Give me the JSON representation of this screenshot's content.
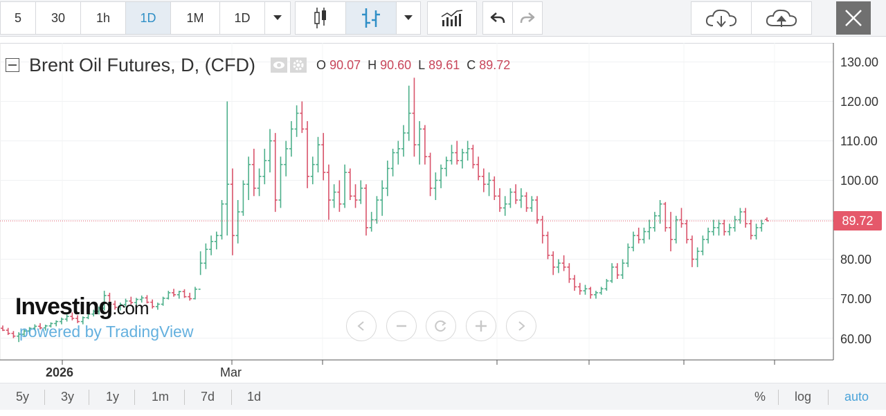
{
  "toolbar": {
    "intervals": [
      {
        "label": "5",
        "active": false
      },
      {
        "label": "30",
        "active": false
      },
      {
        "label": "1h",
        "active": false
      },
      {
        "label": "1D",
        "active": true
      },
      {
        "label": "1M",
        "active": false
      },
      {
        "label": "1D",
        "active": false
      }
    ],
    "icons": [
      "chevron-down-icon",
      "candlestick-icon",
      "ohlc-bars-icon",
      "chevron-down-icon",
      "indicators-icon",
      "undo-icon",
      "redo-icon",
      "cloud-download-icon",
      "cloud-upload-icon",
      "close-icon"
    ]
  },
  "legend": {
    "title": "Brent Oil Futures, D, (CFD)",
    "open_label": "O",
    "open": "90.07",
    "high_label": "H",
    "high": "90.60",
    "low_label": "L",
    "low": "89.61",
    "close_label": "C",
    "close": "89.72"
  },
  "price_tag": "89.72",
  "y_axis_labels": [
    "130.00",
    "120.00",
    "110.00",
    "100.00",
    "80.00",
    "70.00",
    "60.00"
  ],
  "x_axis_labels": {
    "year": "2026",
    "month": "Mar"
  },
  "watermark": {
    "brand": "Investing",
    "brand_suffix": ".com",
    "powered": "powered by TradingView"
  },
  "range_buttons": [
    "5y",
    "3y",
    "1y",
    "1m",
    "7d",
    "1d"
  ],
  "right_options": {
    "percent": "%",
    "log": "log",
    "auto": "auto"
  },
  "colors": {
    "up": "#4caf8a",
    "down": "#d9536a",
    "accent": "#2f8fc6",
    "price_tag": "#e5586a"
  },
  "chart_data": {
    "type": "ohlc",
    "title": "Brent Oil Futures, D, (CFD)",
    "ylim": [
      55,
      133
    ],
    "last_close": 89.72,
    "series": [
      {
        "values": [
          {
            "o": 62.5,
            "h": 63.2,
            "l": 61.8,
            "c": 62.0
          },
          {
            "o": 62.0,
            "h": 62.6,
            "l": 60.8,
            "c": 61.2
          },
          {
            "o": 61.2,
            "h": 61.8,
            "l": 60.0,
            "c": 60.5
          },
          {
            "o": 60.5,
            "h": 61.5,
            "l": 59.0,
            "c": 61.0
          },
          {
            "o": 61.0,
            "h": 62.2,
            "l": 60.5,
            "c": 61.8
          },
          {
            "o": 61.8,
            "h": 62.8,
            "l": 61.2,
            "c": 62.5
          },
          {
            "o": 62.5,
            "h": 63.5,
            "l": 62.0,
            "c": 63.0
          },
          {
            "o": 63.0,
            "h": 63.8,
            "l": 62.2,
            "c": 62.6
          },
          {
            "o": 62.6,
            "h": 63.4,
            "l": 61.9,
            "c": 63.1
          },
          {
            "o": 63.1,
            "h": 64.0,
            "l": 62.7,
            "c": 63.7
          },
          {
            "o": 63.7,
            "h": 64.5,
            "l": 63.0,
            "c": 64.2
          },
          {
            "o": 64.2,
            "h": 65.2,
            "l": 63.5,
            "c": 64.8
          },
          {
            "o": 64.8,
            "h": 66.0,
            "l": 64.2,
            "c": 65.5
          },
          {
            "o": 65.5,
            "h": 66.5,
            "l": 64.5,
            "c": 65.0
          },
          {
            "o": 65.0,
            "h": 65.8,
            "l": 63.8,
            "c": 64.2
          },
          {
            "o": 64.2,
            "h": 65.5,
            "l": 63.5,
            "c": 65.2
          },
          {
            "o": 65.2,
            "h": 66.4,
            "l": 64.8,
            "c": 66.1
          },
          {
            "o": 66.1,
            "h": 67.2,
            "l": 65.5,
            "c": 66.8
          },
          {
            "o": 66.8,
            "h": 68.0,
            "l": 66.0,
            "c": 67.6
          },
          {
            "o": 67.6,
            "h": 72.0,
            "l": 67.0,
            "c": 70.8
          },
          {
            "o": 70.8,
            "h": 71.5,
            "l": 68.0,
            "c": 68.6
          },
          {
            "o": 68.6,
            "h": 69.5,
            "l": 67.2,
            "c": 67.8
          },
          {
            "o": 67.8,
            "h": 69.0,
            "l": 67.0,
            "c": 68.5
          },
          {
            "o": 68.5,
            "h": 70.0,
            "l": 67.9,
            "c": 69.4
          },
          {
            "o": 69.4,
            "h": 70.5,
            "l": 68.5,
            "c": 69.0
          },
          {
            "o": 69.0,
            "h": 70.2,
            "l": 68.3,
            "c": 69.8
          },
          {
            "o": 69.8,
            "h": 70.8,
            "l": 69.0,
            "c": 70.2
          },
          {
            "o": 70.2,
            "h": 70.9,
            "l": 68.8,
            "c": 69.1
          },
          {
            "o": 69.1,
            "h": 69.8,
            "l": 67.5,
            "c": 68.0
          },
          {
            "o": 68.0,
            "h": 69.0,
            "l": 67.2,
            "c": 68.6
          },
          {
            "o": 68.6,
            "h": 70.5,
            "l": 68.2,
            "c": 70.1
          },
          {
            "o": 70.1,
            "h": 72.0,
            "l": 69.8,
            "c": 71.5
          },
          {
            "o": 71.5,
            "h": 72.5,
            "l": 70.5,
            "c": 71.0
          },
          {
            "o": 71.0,
            "h": 72.0,
            "l": 70.0,
            "c": 71.8
          },
          {
            "o": 71.8,
            "h": 72.4,
            "l": 70.2,
            "c": 70.5
          },
          {
            "o": 70.5,
            "h": 71.5,
            "l": 69.5,
            "c": 70.0
          },
          {
            "o": 70.0,
            "h": 73.0,
            "l": 69.8,
            "c": 72.4
          },
          {
            "o": 72.4,
            "h": 82.0,
            "l": 76.0,
            "c": 79.0
          },
          {
            "o": 79.0,
            "h": 84.0,
            "l": 77.5,
            "c": 82.5
          },
          {
            "o": 82.5,
            "h": 86.0,
            "l": 81.0,
            "c": 84.5
          },
          {
            "o": 84.5,
            "h": 87.0,
            "l": 82.5,
            "c": 86.0
          },
          {
            "o": 86.0,
            "h": 95.0,
            "l": 85.0,
            "c": 94.0
          },
          {
            "o": 94.0,
            "h": 120.0,
            "l": 86.0,
            "c": 99.0
          },
          {
            "o": 99.0,
            "h": 103.0,
            "l": 81.0,
            "c": 86.0
          },
          {
            "o": 86.0,
            "h": 95.0,
            "l": 84.0,
            "c": 92.0
          },
          {
            "o": 92.0,
            "h": 100.0,
            "l": 91.0,
            "c": 99.0
          },
          {
            "o": 99.0,
            "h": 106.0,
            "l": 95.0,
            "c": 104.0
          },
          {
            "o": 104.0,
            "h": 108.0,
            "l": 96.0,
            "c": 98.0
          },
          {
            "o": 98.0,
            "h": 103.0,
            "l": 96.0,
            "c": 101.0
          },
          {
            "o": 101.0,
            "h": 108.0,
            "l": 99.0,
            "c": 105.0
          },
          {
            "o": 105.0,
            "h": 113.0,
            "l": 102.0,
            "c": 110.0
          },
          {
            "o": 110.0,
            "h": 112.0,
            "l": 92.0,
            "c": 95.0
          },
          {
            "o": 95.0,
            "h": 106.0,
            "l": 93.0,
            "c": 104.0
          },
          {
            "o": 104.0,
            "h": 110.0,
            "l": 101.0,
            "c": 108.0
          },
          {
            "o": 108.0,
            "h": 115.0,
            "l": 106.0,
            "c": 113.0
          },
          {
            "o": 113.0,
            "h": 119.0,
            "l": 111.0,
            "c": 117.0
          },
          {
            "o": 117.0,
            "h": 120.0,
            "l": 112.0,
            "c": 113.0
          },
          {
            "o": 113.0,
            "h": 115.0,
            "l": 98.0,
            "c": 101.0
          },
          {
            "o": 101.0,
            "h": 106.0,
            "l": 99.0,
            "c": 104.0
          },
          {
            "o": 104.0,
            "h": 111.0,
            "l": 102.0,
            "c": 109.0
          },
          {
            "o": 109.0,
            "h": 112.0,
            "l": 100.0,
            "c": 102.0
          },
          {
            "o": 102.0,
            "h": 104.0,
            "l": 90.0,
            "c": 95.0
          },
          {
            "o": 95.0,
            "h": 99.0,
            "l": 93.0,
            "c": 97.0
          },
          {
            "o": 97.0,
            "h": 100.0,
            "l": 92.0,
            "c": 94.0
          },
          {
            "o": 94.0,
            "h": 104.0,
            "l": 93.0,
            "c": 102.0
          },
          {
            "o": 102.0,
            "h": 103.0,
            "l": 95.0,
            "c": 96.0
          },
          {
            "o": 96.0,
            "h": 99.0,
            "l": 93.0,
            "c": 95.0
          },
          {
            "o": 95.0,
            "h": 100.0,
            "l": 94.0,
            "c": 98.0
          },
          {
            "o": 98.0,
            "h": 99.0,
            "l": 86.0,
            "c": 88.0
          },
          {
            "o": 88.0,
            "h": 92.0,
            "l": 87.0,
            "c": 90.0
          },
          {
            "o": 90.0,
            "h": 96.0,
            "l": 89.0,
            "c": 95.0
          },
          {
            "o": 95.0,
            "h": 100.0,
            "l": 91.0,
            "c": 98.0
          },
          {
            "o": 98.0,
            "h": 105.0,
            "l": 96.0,
            "c": 103.0
          },
          {
            "o": 103.0,
            "h": 108.0,
            "l": 101.0,
            "c": 107.0
          },
          {
            "o": 107.0,
            "h": 110.0,
            "l": 104.0,
            "c": 108.0
          },
          {
            "o": 108.0,
            "h": 114.0,
            "l": 106.0,
            "c": 112.0
          },
          {
            "o": 112.0,
            "h": 124.0,
            "l": 110.0,
            "c": 117.0
          },
          {
            "o": 117.0,
            "h": 126.0,
            "l": 106.0,
            "c": 109.0
          },
          {
            "o": 109.0,
            "h": 115.0,
            "l": 104.0,
            "c": 113.0
          },
          {
            "o": 113.0,
            "h": 114.0,
            "l": 104.0,
            "c": 106.0
          },
          {
            "o": 106.0,
            "h": 107.0,
            "l": 96.0,
            "c": 98.0
          },
          {
            "o": 98.0,
            "h": 102.0,
            "l": 95.0,
            "c": 100.0
          },
          {
            "o": 100.0,
            "h": 104.0,
            "l": 98.0,
            "c": 103.0
          },
          {
            "o": 103.0,
            "h": 106.0,
            "l": 101.0,
            "c": 105.0
          },
          {
            "o": 105.0,
            "h": 109.0,
            "l": 104.0,
            "c": 107.0
          },
          {
            "o": 107.0,
            "h": 110.0,
            "l": 104.0,
            "c": 105.0
          },
          {
            "o": 105.0,
            "h": 108.0,
            "l": 103.0,
            "c": 107.0
          },
          {
            "o": 107.0,
            "h": 110.0,
            "l": 105.0,
            "c": 108.0
          },
          {
            "o": 108.0,
            "h": 109.0,
            "l": 103.0,
            "c": 104.0
          },
          {
            "o": 104.0,
            "h": 106.0,
            "l": 100.0,
            "c": 101.0
          },
          {
            "o": 101.0,
            "h": 103.0,
            "l": 97.0,
            "c": 99.0
          },
          {
            "o": 99.0,
            "h": 102.0,
            "l": 96.0,
            "c": 100.0
          },
          {
            "o": 100.0,
            "h": 101.0,
            "l": 95.0,
            "c": 96.0
          },
          {
            "o": 96.0,
            "h": 98.0,
            "l": 92.0,
            "c": 93.0
          },
          {
            "o": 93.0,
            "h": 96.0,
            "l": 91.0,
            "c": 94.0
          },
          {
            "o": 94.0,
            "h": 98.0,
            "l": 93.0,
            "c": 97.0
          },
          {
            "o": 97.0,
            "h": 99.0,
            "l": 94.0,
            "c": 95.0
          },
          {
            "o": 95.0,
            "h": 98.0,
            "l": 93.0,
            "c": 96.0
          },
          {
            "o": 96.0,
            "h": 97.0,
            "l": 92.0,
            "c": 93.0
          },
          {
            "o": 93.0,
            "h": 96.0,
            "l": 92.0,
            "c": 95.0
          },
          {
            "o": 95.0,
            "h": 96.0,
            "l": 89.0,
            "c": 90.0
          },
          {
            "o": 90.0,
            "h": 91.0,
            "l": 84.0,
            "c": 86.0
          },
          {
            "o": 86.0,
            "h": 87.0,
            "l": 80.0,
            "c": 81.0
          },
          {
            "o": 81.0,
            "h": 82.0,
            "l": 76.0,
            "c": 78.0
          },
          {
            "o": 78.0,
            "h": 80.0,
            "l": 76.5,
            "c": 79.0
          },
          {
            "o": 79.0,
            "h": 81.0,
            "l": 77.0,
            "c": 78.0
          },
          {
            "o": 78.0,
            "h": 79.0,
            "l": 74.0,
            "c": 75.0
          },
          {
            "o": 75.0,
            "h": 76.0,
            "l": 72.0,
            "c": 73.0
          },
          {
            "o": 73.0,
            "h": 74.0,
            "l": 71.0,
            "c": 72.0
          },
          {
            "o": 72.0,
            "h": 73.5,
            "l": 71.0,
            "c": 72.5
          },
          {
            "o": 72.5,
            "h": 73.0,
            "l": 70.0,
            "c": 71.0
          },
          {
            "o": 71.0,
            "h": 72.0,
            "l": 70.0,
            "c": 71.5
          },
          {
            "o": 71.5,
            "h": 73.0,
            "l": 71.0,
            "c": 72.5
          },
          {
            "o": 72.5,
            "h": 75.0,
            "l": 72.0,
            "c": 74.5
          },
          {
            "o": 74.5,
            "h": 79.0,
            "l": 74.0,
            "c": 78.0
          },
          {
            "o": 78.0,
            "h": 79.0,
            "l": 75.0,
            "c": 76.0
          },
          {
            "o": 76.0,
            "h": 80.0,
            "l": 75.0,
            "c": 79.0
          },
          {
            "o": 79.0,
            "h": 84.0,
            "l": 78.0,
            "c": 83.0
          },
          {
            "o": 83.0,
            "h": 87.0,
            "l": 82.0,
            "c": 86.0
          },
          {
            "o": 86.0,
            "h": 88.0,
            "l": 84.0,
            "c": 85.0
          },
          {
            "o": 85.0,
            "h": 88.0,
            "l": 84.0,
            "c": 87.0
          },
          {
            "o": 87.0,
            "h": 90.0,
            "l": 85.0,
            "c": 88.0
          },
          {
            "o": 88.0,
            "h": 92.0,
            "l": 87.0,
            "c": 91.0
          },
          {
            "o": 91.0,
            "h": 95.0,
            "l": 89.0,
            "c": 94.0
          },
          {
            "o": 94.0,
            "h": 94.5,
            "l": 87.0,
            "c": 88.0
          },
          {
            "o": 88.0,
            "h": 92.0,
            "l": 82.0,
            "c": 85.0
          },
          {
            "o": 85.0,
            "h": 91.0,
            "l": 84.0,
            "c": 90.0
          },
          {
            "o": 90.0,
            "h": 93.0,
            "l": 88.0,
            "c": 89.0
          },
          {
            "o": 89.0,
            "h": 90.0,
            "l": 84.0,
            "c": 85.0
          },
          {
            "o": 85.0,
            "h": 86.0,
            "l": 78.0,
            "c": 80.0
          },
          {
            "o": 80.0,
            "h": 83.0,
            "l": 78.0,
            "c": 82.0
          },
          {
            "o": 82.0,
            "h": 86.0,
            "l": 81.0,
            "c": 85.0
          },
          {
            "o": 85.0,
            "h": 88.0,
            "l": 84.0,
            "c": 87.0
          },
          {
            "o": 87.0,
            "h": 90.0,
            "l": 86.0,
            "c": 88.0
          },
          {
            "o": 88.0,
            "h": 90.0,
            "l": 86.0,
            "c": 89.0
          },
          {
            "o": 89.0,
            "h": 90.0,
            "l": 86.0,
            "c": 87.0
          },
          {
            "o": 87.0,
            "h": 89.0,
            "l": 86.0,
            "c": 88.0
          },
          {
            "o": 88.0,
            "h": 91.0,
            "l": 87.0,
            "c": 90.0
          },
          {
            "o": 90.0,
            "h": 93.0,
            "l": 89.0,
            "c": 92.0
          },
          {
            "o": 92.0,
            "h": 93.0,
            "l": 88.0,
            "c": 89.0
          },
          {
            "o": 89.0,
            "h": 90.0,
            "l": 85.0,
            "c": 86.0
          },
          {
            "o": 86.0,
            "h": 89.0,
            "l": 85.0,
            "c": 88.0
          },
          {
            "o": 88.0,
            "h": 90.0,
            "l": 87.0,
            "c": 89.0
          },
          {
            "o": 90.07,
            "h": 90.6,
            "l": 89.61,
            "c": 89.72
          }
        ]
      }
    ]
  }
}
